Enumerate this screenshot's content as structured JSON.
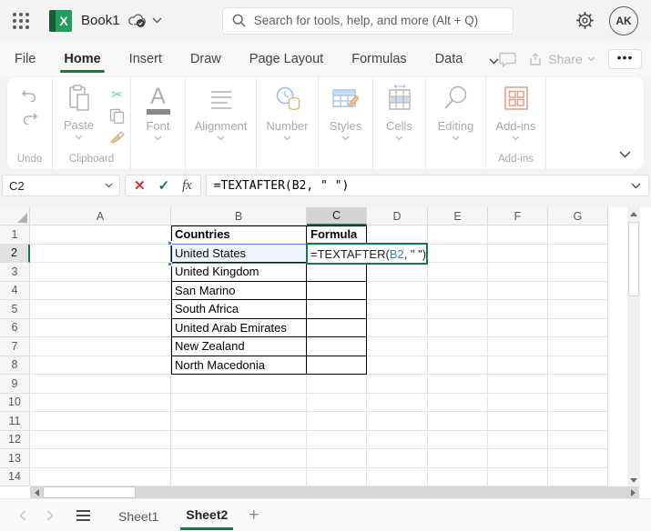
{
  "topbar": {
    "title": "Book1",
    "search_placeholder": "Search for tools, help, and more (Alt + Q)",
    "avatar_initials": "AK"
  },
  "menubar": {
    "tabs": [
      "File",
      "Home",
      "Insert",
      "Draw",
      "Page Layout",
      "Formulas",
      "Data"
    ],
    "active_tab": "Home",
    "share_label": "Share",
    "more_label": "•••"
  },
  "ribbon": {
    "undo_group_label": "Undo",
    "paste_label": "Paste",
    "clipboard_group_label": "Clipboard",
    "font_label": "Font",
    "alignment_label": "Alignment",
    "number_label": "Number",
    "styles_label": "Styles",
    "cells_label": "Cells",
    "editing_label": "Editing",
    "addins_label": "Add-ins",
    "addins_group_label": "Add-ins",
    "font_glyph": "A",
    "cut_glyph": "✂"
  },
  "formula_bar": {
    "name_box_value": "C2",
    "fx_label": "fx",
    "formula_text": "=TEXTAFTER(B2, \" \")"
  },
  "grid": {
    "columns": [
      "A",
      "B",
      "C",
      "D",
      "E",
      "F",
      "G"
    ],
    "selected_column": "C",
    "rows": [
      "1",
      "2",
      "3",
      "4",
      "5",
      "6",
      "7",
      "8",
      "9",
      "10",
      "11",
      "12",
      "13",
      "14"
    ],
    "selected_row": "2",
    "cells": {
      "B1": "Countries",
      "C1": "Formula",
      "B2": "United States",
      "B3": "United Kingdom",
      "B4": "San Marino",
      "B5": "South Africa",
      "B6": "United Arab Emirates",
      "B7": "New Zealand",
      "B8": "North Macedonia"
    },
    "edit_cell": {
      "address": "C2",
      "prefix": "=TEXTAFTER(",
      "ref": "B2",
      "suffix": ", \" \")"
    }
  },
  "sheet_tabs": {
    "tabs": [
      "Sheet1",
      "Sheet2"
    ],
    "active": "Sheet2"
  },
  "colors": {
    "accent_green": "#107c41",
    "underline_green": "#217346",
    "reference_blue": "#3d7ad1",
    "selection_blue": "#4a7dd6",
    "cancel_red": "#d13438"
  }
}
